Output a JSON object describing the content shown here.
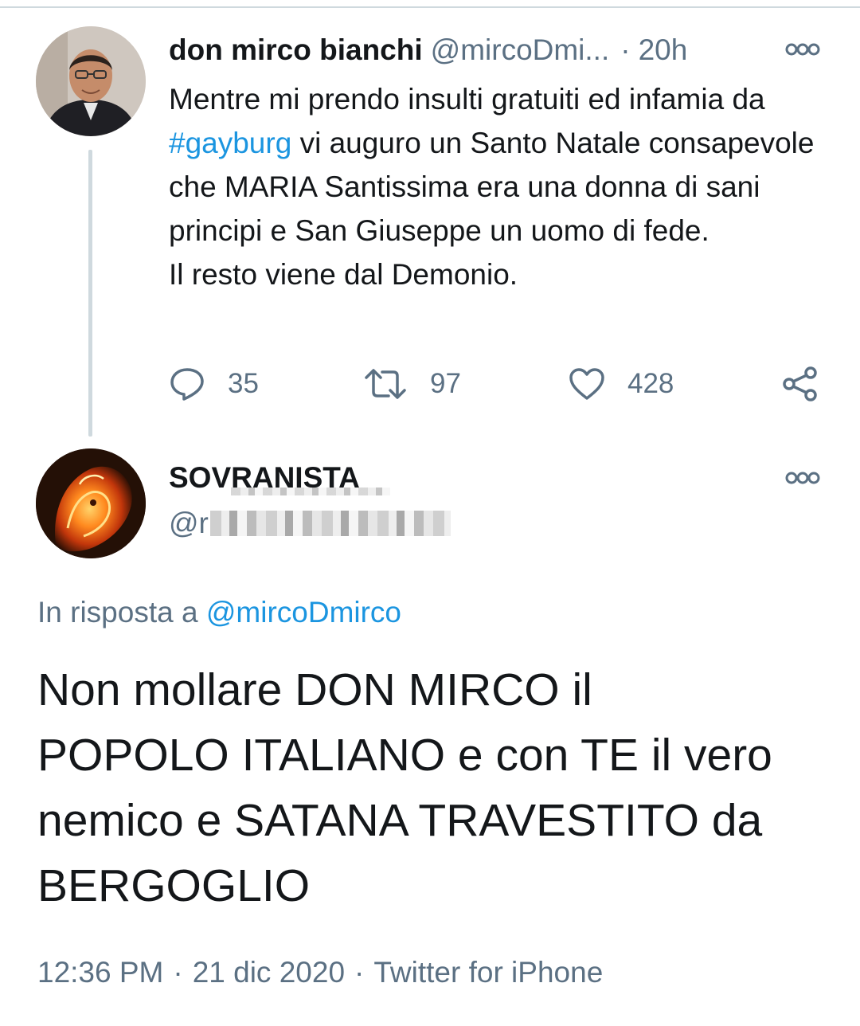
{
  "parent_tweet": {
    "display_name": "don mirco bianchi",
    "handle": "@mircoDmi...",
    "separator": "·",
    "time": "20h",
    "text_before_hashtag": "Mentre mi prendo insulti gratuiti ed infamia da ",
    "hashtag": "#gayburg",
    "text_after_hashtag": " vi auguro un Santo Natale consapevole che MARIA Santissima era una donna di sani principi e San Giuseppe un uomo di fede.",
    "text_line2": "Il resto viene dal Demonio.",
    "reply_count": "35",
    "retweet_count": "97",
    "like_count": "428",
    "icons": [
      "reply-icon",
      "retweet-icon",
      "like-icon",
      "share-icon",
      "more-options-icon"
    ]
  },
  "reply_tweet": {
    "display_name": "SOVRANISTA",
    "handle_visible": "@ri",
    "in_reply_prefix": "In risposta a ",
    "in_reply_mention": "@mircoDmirco",
    "text_lines": [
      "Non mollare DON MIRCO il",
      "POPOLO ITALIANO e con TE il vero",
      "nemico e SATANA TRAVESTITO da",
      "BERGOGLIO"
    ],
    "time": "12:36 PM",
    "date": "21 dic 2020",
    "source": "Twitter for iPhone",
    "meta_separator": "·"
  },
  "colors": {
    "text": "#14171a",
    "secondary": "#5b7083",
    "link": "#1b95e0",
    "divider": "#cfd9de"
  }
}
